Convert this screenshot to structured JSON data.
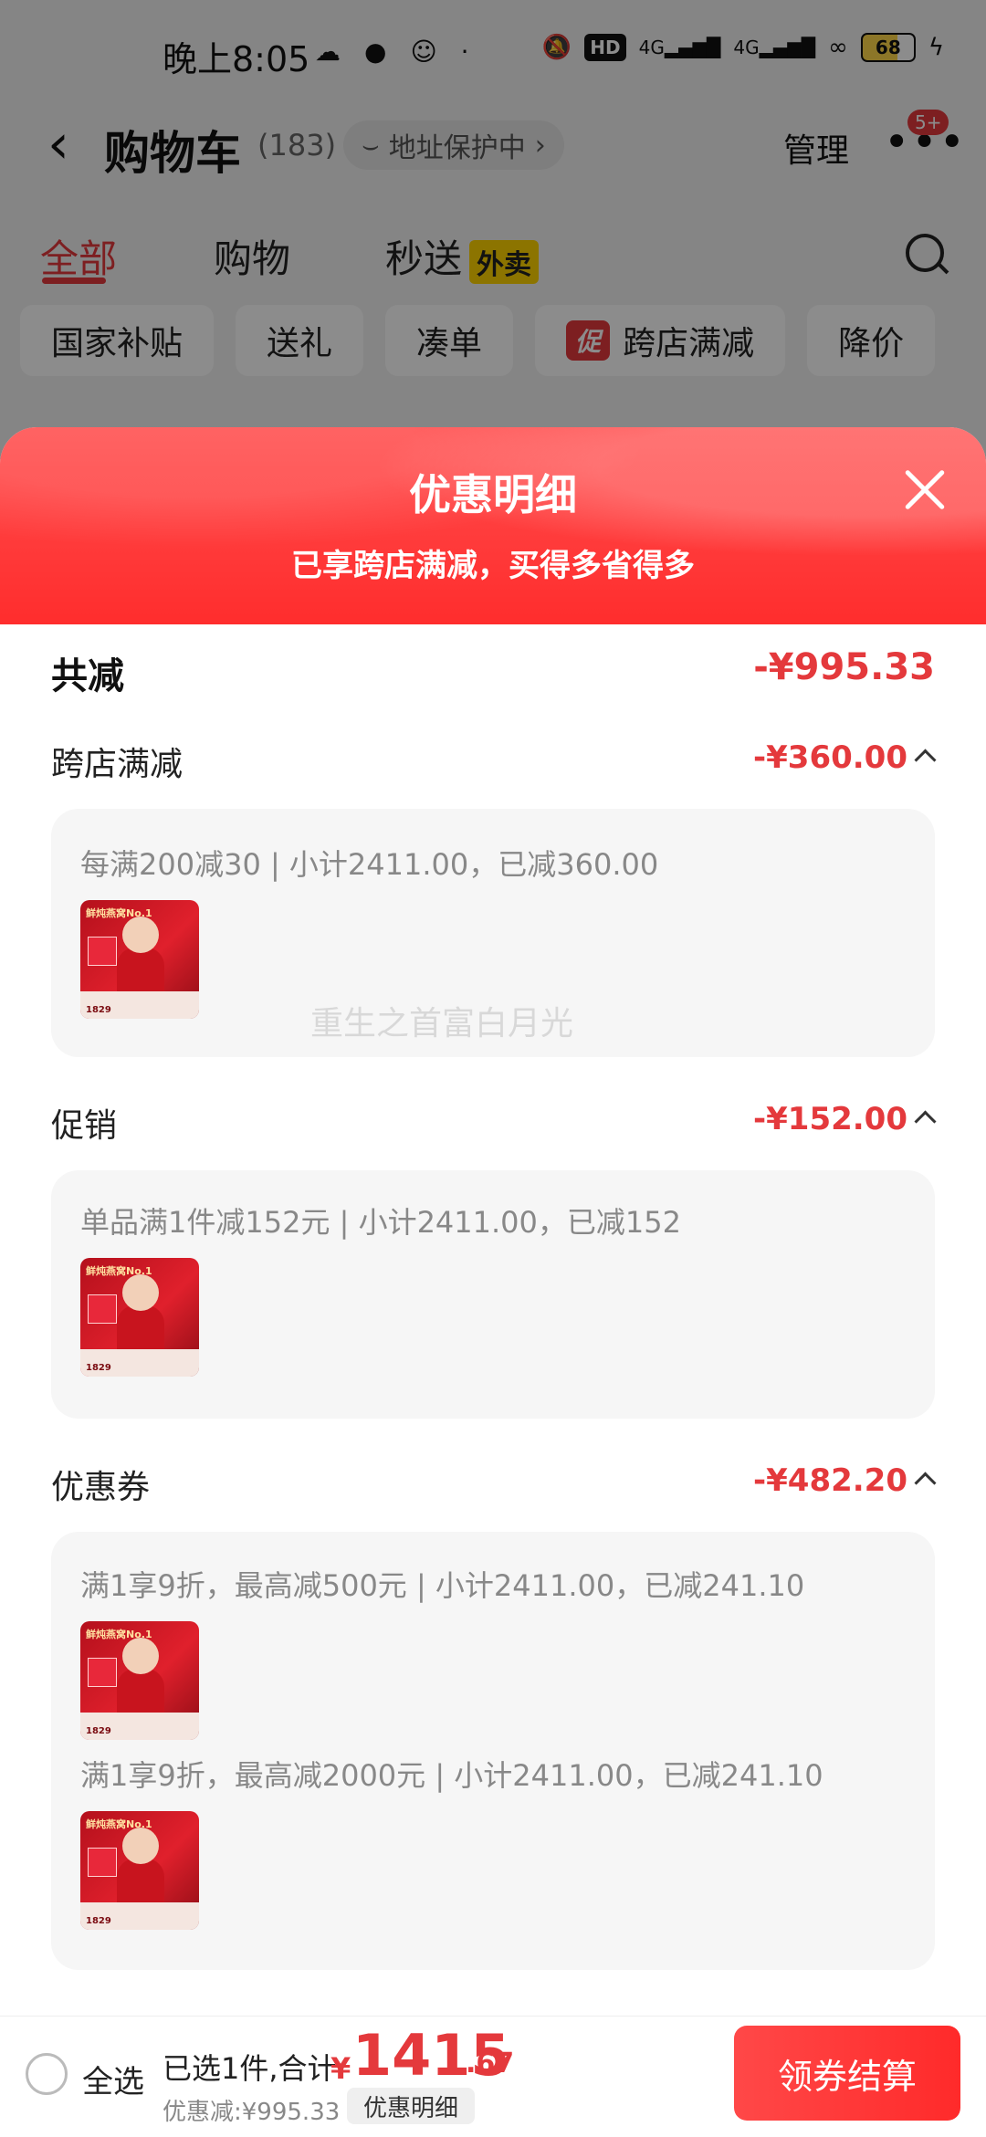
{
  "status_bar": {
    "time": "晚上8:05",
    "hd": "HD",
    "network1": "4G",
    "network2": "4G",
    "battery": "68"
  },
  "cart_header": {
    "title": "购物车",
    "count": "(183)",
    "address_protection": "地址保护中",
    "manage": "管理",
    "message_badge": "5+"
  },
  "tabs": [
    {
      "label": "全部"
    },
    {
      "label": "购物"
    },
    {
      "label": "秒送"
    }
  ],
  "takeout_badge": "外卖",
  "filters": [
    {
      "label": "国家补贴"
    },
    {
      "label": "送礼"
    },
    {
      "label": "凑单"
    },
    {
      "label": "跨店满减"
    },
    {
      "label": "降价"
    }
  ],
  "promo_tag": "促",
  "sheet": {
    "title": "优惠明细",
    "subtitle": "已享跨店满减，买得多省得多",
    "total_label": "共减",
    "total_value": "-¥995.33",
    "sections": [
      {
        "label": "跨店满减",
        "value": "-¥360.00",
        "rules": [
          "每满200减30 | 小计2411.00，已减360.00"
        ]
      },
      {
        "label": "促销",
        "value": "-¥152.00",
        "rules": [
          "单品满1件减152元 | 小计2411.00，已减152"
        ]
      },
      {
        "label": "优惠券",
        "value": "-¥482.20",
        "rules": [
          "满1享9折，最高减500元 | 小计2411.00，已减241.10",
          "满1享9折，最高减2000元 | 小计2411.00，已减241.10"
        ]
      }
    ],
    "thumb_top_text": "鲜炖燕窝No.1",
    "thumb_price_text": "1829"
  },
  "watermark": "重生之首富白月光",
  "bottom_bar": {
    "select_all": "全选",
    "selected_summary": "已选1件,合计:",
    "currency": "¥",
    "price_integer": "1415",
    "price_decimal": ".67",
    "discount_text": "优惠减:¥995.33",
    "detail_chip": "优惠明细",
    "checkout": "领券结算"
  },
  "colors": {
    "accent": "#e4393c",
    "header_gradient_top": "#ff4d4d",
    "card_bg": "#f6f6f6"
  }
}
